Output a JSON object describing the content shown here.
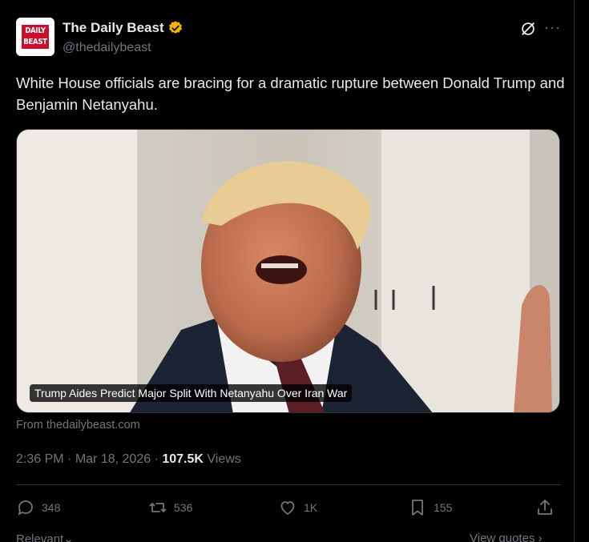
{
  "account": {
    "name": "The Daily Beast",
    "handle": "@thedailybeast",
    "logo_line1": "DAILY",
    "logo_line2": "BEAST",
    "verified_color": "#f4b400"
  },
  "tweet": {
    "text": "White House officials are bracing for a dramatic rupture between Donald Trump and Benjamin Netanyahu."
  },
  "card": {
    "caption": "Trump Aides Predict Major Split With Netanyahu Over Iran War",
    "source": "From thedailybeast.com"
  },
  "meta": {
    "time": "2:36 PM",
    "separator": "·",
    "date": "Mar 18, 2026",
    "views_count": "107.5K",
    "views_label": "Views"
  },
  "actions": {
    "replies": "348",
    "reposts": "536",
    "likes": "1K",
    "bookmarks": "155"
  },
  "bottom": {
    "sort_label": "Relevant",
    "quotes_label": "View quotes"
  },
  "icons": {
    "grok": "grok-icon",
    "more": "more-icon",
    "reply": "reply-icon",
    "repost": "repost-icon",
    "like": "heart-icon",
    "bookmark": "bookmark-icon",
    "share": "share-icon"
  }
}
